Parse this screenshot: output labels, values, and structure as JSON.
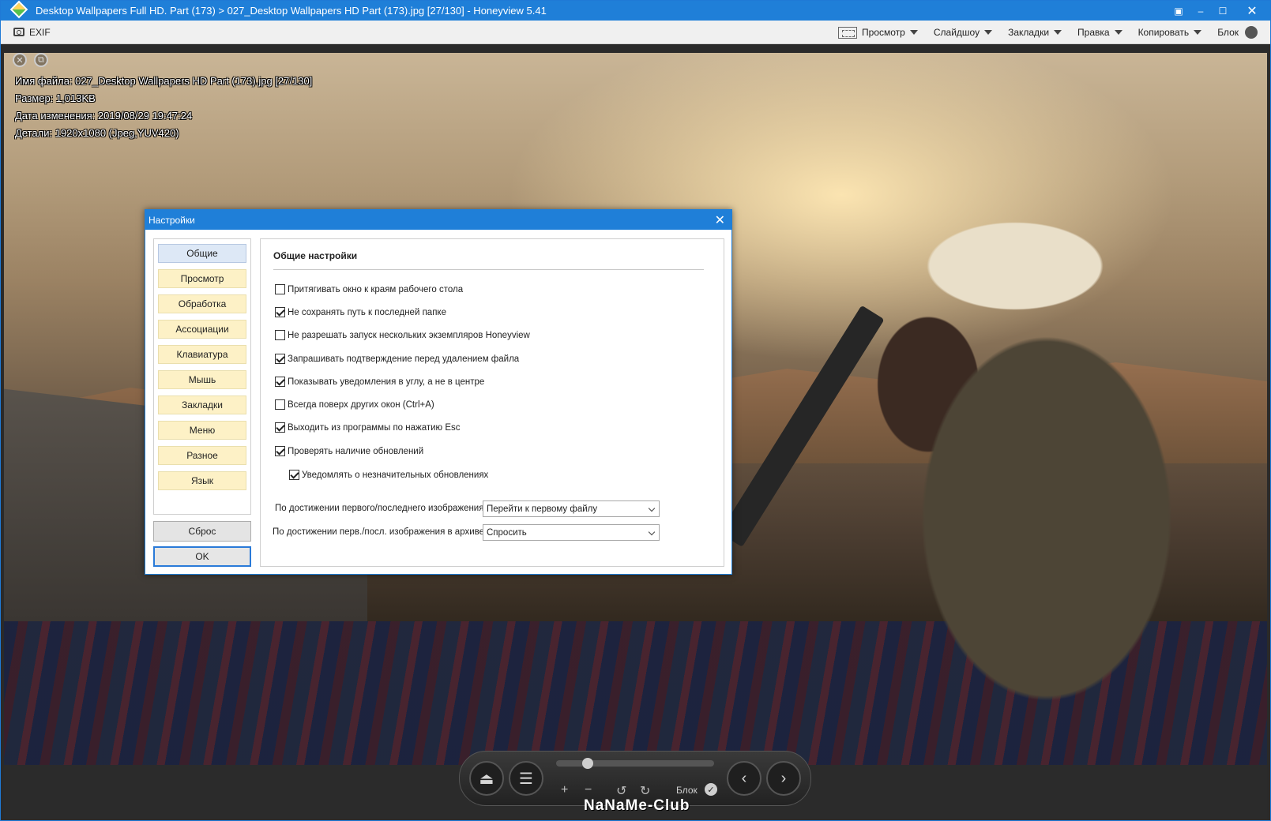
{
  "window": {
    "title": "Desktop Wallpapers Full HD. Part (173) > 027_Desktop Wallpapers  HD Part (173).jpg [27/130] - Honeyview 5.41",
    "buttons": {
      "pin": "▣",
      "minimize": "–",
      "maximize": "☐",
      "close": "✕"
    }
  },
  "toolbar": {
    "exif_label": "EXIF",
    "menus": [
      "Просмотр",
      "Слайдшоу",
      "Закладки",
      "Правка",
      "Копировать"
    ],
    "block_label": "Блок"
  },
  "viewer": {
    "info": {
      "filename": "Имя файла: 027_Desktop Wallpapers HD Part (173).jpg [27/130]",
      "size": "Размер: 1,013KB",
      "modified": "Дата изменения: 2019/08/29 19:47:24",
      "details": "Детали: 1920x1080 (Jpeg,YUV420)"
    }
  },
  "dialog": {
    "title": "Настройки",
    "nav": [
      "Общие",
      "Просмотр",
      "Обработка",
      "Ассоциации",
      "Клавиатура",
      "Мышь",
      "Закладки",
      "Меню",
      "Разное",
      "Язык"
    ],
    "active_nav": "Общие",
    "reset_label": "Сброс",
    "ok_label": "OK",
    "section_title": "Общие настройки",
    "options": [
      {
        "label": "Притягивать окно к краям рабочего стола",
        "checked": false
      },
      {
        "label": "Не сохранять путь к последней папке",
        "checked": true
      },
      {
        "label": "Не разрешать запуск нескольких экземпляров Honeyview",
        "checked": false
      },
      {
        "label": "Запрашивать подтверждение перед удалением файла",
        "checked": true
      },
      {
        "label": "Показывать уведомления в углу, а не в центре",
        "checked": true
      },
      {
        "label": "Всегда поверх других окон (Ctrl+A)",
        "checked": false
      },
      {
        "label": "Выходить из программы по нажатию Esc",
        "checked": true
      },
      {
        "label": "Проверять наличие обновлений",
        "checked": true
      },
      {
        "label": "Уведомлять о незначительных обновлениях",
        "checked": true
      }
    ],
    "first_last_label": "По достижении первого/последнего изображения:",
    "first_last_value": "Перейти к первому файлу",
    "archive_label": "По достижении перв./посл. изображения в архиве:",
    "archive_value": "Спросить"
  },
  "dock": {
    "block_label": "Блок",
    "slider_position": 0.2
  },
  "watermark": "NaNaMe-Club"
}
